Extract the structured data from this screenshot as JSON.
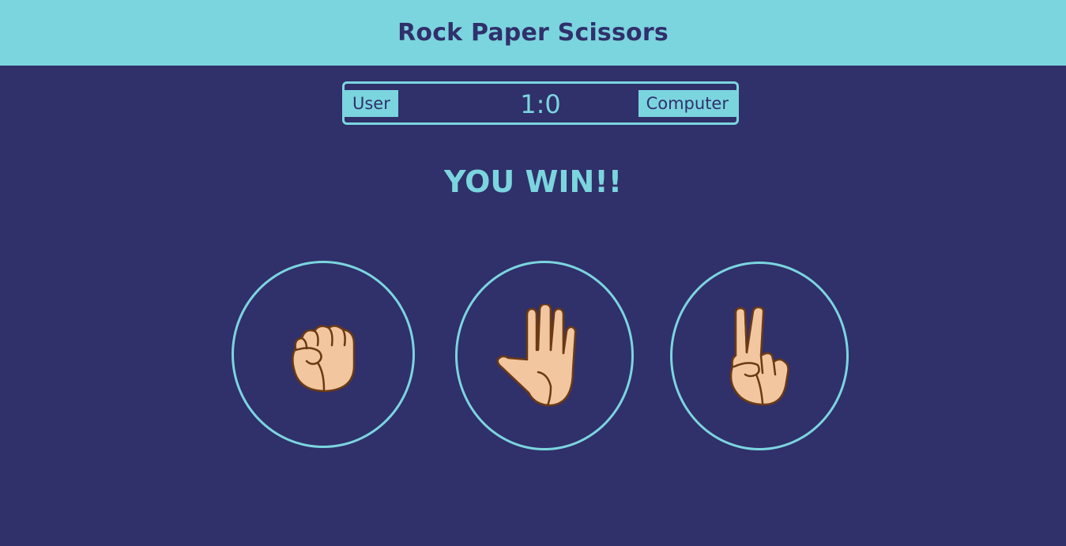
{
  "header": {
    "title": "Rock Paper Scissors"
  },
  "scoreboard": {
    "user_label": "User",
    "score": "1:0",
    "computer_label": "Computer"
  },
  "result": {
    "message": "YOU WIN!!"
  },
  "choices": [
    {
      "icon": "rock-fist-icon"
    },
    {
      "icon": "paper-hand-icon"
    },
    {
      "icon": "scissors-victory-hand-icon"
    }
  ],
  "colors": {
    "background": "#30306b",
    "accent": "#7bd5de",
    "skin": "#f2c7a0",
    "outline": "#6b3a14"
  }
}
